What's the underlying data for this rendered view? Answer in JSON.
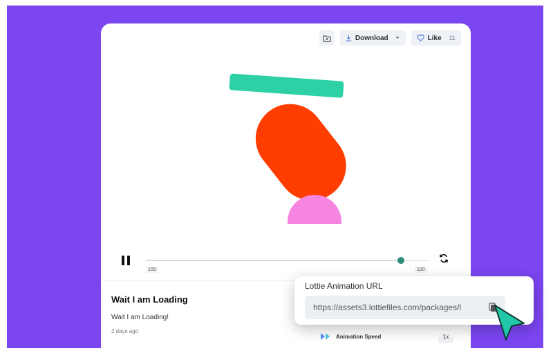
{
  "toolbar": {
    "download_label": "Download",
    "like_label": "Like",
    "like_count": "11"
  },
  "player": {
    "frame_start": "109",
    "frame_end": "120",
    "progress": 0.9
  },
  "animation": {
    "info_title": "Wait I am Loading",
    "info_subtitle": "Wait I am Loading!",
    "info_date": "2 days ago"
  },
  "url_panel": {
    "label": "Lottie Animation URL",
    "url": "https://assets3.lottiefiles.com/packages/l"
  },
  "speed": {
    "label": "Animation Speed",
    "value": "1x"
  },
  "colors": {
    "background": "#7b45f0",
    "bar": "#2ed1a6",
    "pill": "#ff3d00",
    "dome": "#f585e1",
    "accent": "#2f8c7a",
    "cursor": "#22c7a9"
  }
}
